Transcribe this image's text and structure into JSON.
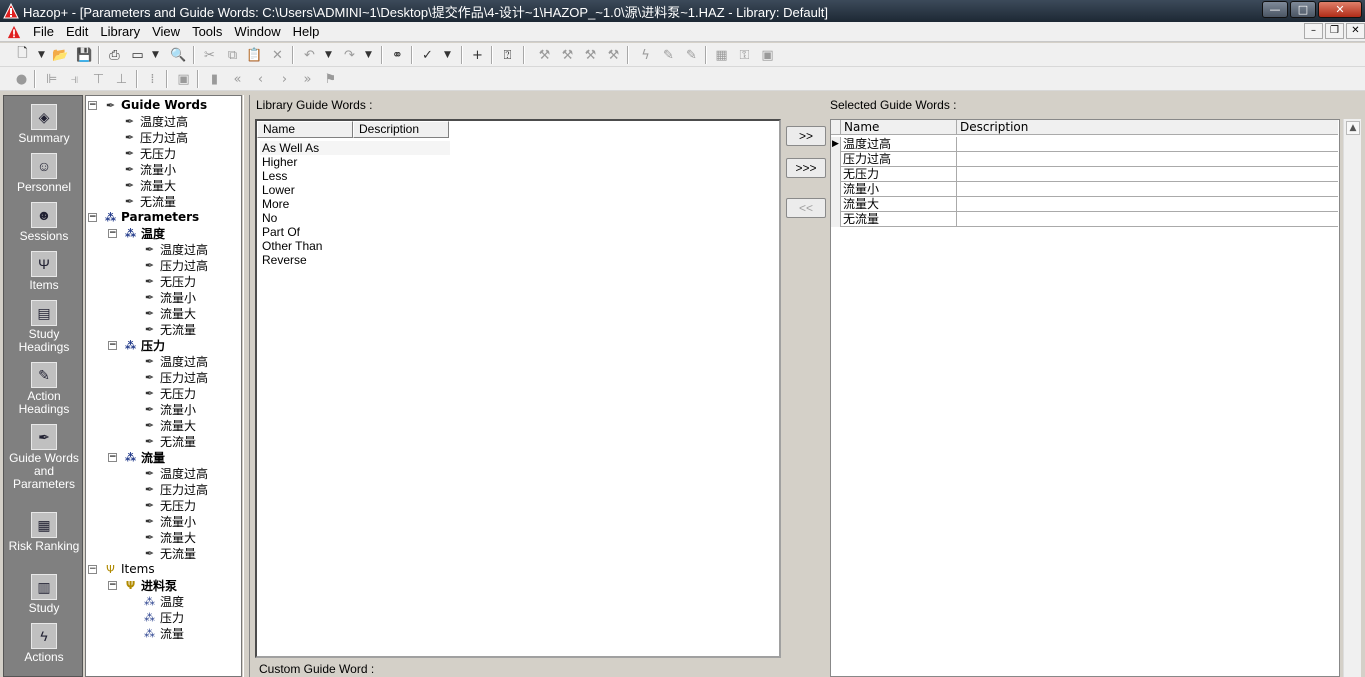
{
  "window": {
    "title": "Hazop+ - [Parameters and Guide Words: C:\\Users\\ADMINI~1\\Desktop\\提交作品\\4-设计~1\\HAZOP_~1.0\\源\\进料泵~1.HAZ - Library: Default]",
    "minimize": "—",
    "maximize": "□",
    "close": "✕"
  },
  "menu": [
    "File",
    "Edit",
    "Library",
    "View",
    "Tools",
    "Window",
    "Help"
  ],
  "mdi_controls": [
    "–",
    "❐",
    "✕"
  ],
  "nav": [
    {
      "label": "Summary",
      "icon": "summary-icon",
      "glyph": "◈"
    },
    {
      "label": "Personnel",
      "icon": "personnel-icon",
      "glyph": "☺"
    },
    {
      "label": "Sessions",
      "icon": "sessions-icon",
      "glyph": "☻"
    },
    {
      "label": "Items",
      "icon": "items-icon",
      "glyph": "Ψ"
    },
    {
      "label": "Study Headings",
      "icon": "study-headings-icon",
      "glyph": "▤"
    },
    {
      "label": "Action Headings",
      "icon": "action-headings-icon",
      "glyph": "✎"
    },
    {
      "label": "Guide Words and Parameters",
      "icon": "guide-words-icon",
      "glyph": "✒"
    },
    {
      "label": "Risk Ranking",
      "icon": "risk-ranking-icon",
      "glyph": "▦"
    },
    {
      "label": "Study",
      "icon": "study-icon",
      "glyph": "▥"
    },
    {
      "label": "Actions",
      "icon": "actions-icon",
      "glyph": "ϟ"
    }
  ],
  "tree": {
    "guide_words_label": "Guide Words",
    "guide_words": [
      "温度过高",
      "压力过高",
      "无压力",
      "流量小",
      "流量大",
      "无流量"
    ],
    "parameters_label": "Parameters",
    "parameters": [
      {
        "name": "温度",
        "children": [
          "温度过高",
          "压力过高",
          "无压力",
          "流量小",
          "流量大",
          "无流量"
        ]
      },
      {
        "name": "压力",
        "children": [
          "温度过高",
          "压力过高",
          "无压力",
          "流量小",
          "流量大",
          "无流量"
        ]
      },
      {
        "name": "流量",
        "children": [
          "温度过高",
          "压力过高",
          "无压力",
          "流量小",
          "流量大",
          "无流量"
        ]
      }
    ],
    "items_label": "Items",
    "item": {
      "name": "进料泵",
      "children": [
        "温度",
        "压力",
        "流量"
      ]
    }
  },
  "library": {
    "label": "Library Guide Words :",
    "col_name": "Name",
    "col_desc": "Description",
    "items": [
      "As Well As",
      "Higher",
      "Less",
      "Lower",
      "More",
      "No",
      "Part Of",
      "Other Than",
      "Reverse"
    ]
  },
  "buttons": {
    "add": ">>",
    "add_all": ">>>",
    "remove": "<<"
  },
  "selected": {
    "label": "Selected Guide Words :",
    "col_name": "Name",
    "col_desc": "Description",
    "rows": [
      "温度过高",
      "压力过高",
      "无压力",
      "流量小",
      "流量大",
      "无流量"
    ]
  },
  "custom_label": "Custom Guide Word :"
}
